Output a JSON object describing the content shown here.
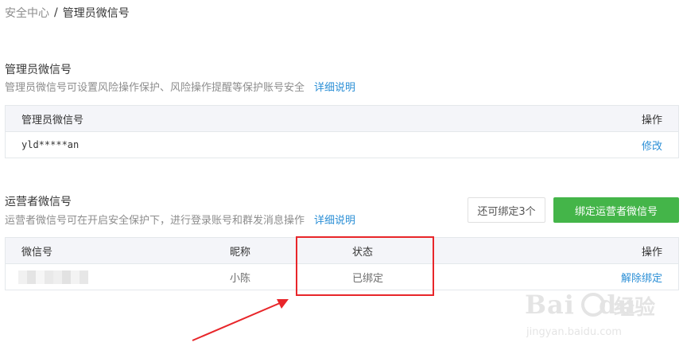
{
  "breadcrumb": {
    "parent": "安全中心",
    "separator": "/",
    "current": "管理员微信号"
  },
  "admin_section": {
    "title": "管理员微信号",
    "description": "管理员微信号可设置风险操作保护、风险操作提醒等保护账号安全",
    "detail_link": "详细说明",
    "table": {
      "headers": {
        "wechat_id": "管理员微信号",
        "action": "操作"
      },
      "rows": [
        {
          "wechat_id": "yld*****an",
          "action": "修改"
        }
      ]
    }
  },
  "operator_section": {
    "title": "运营者微信号",
    "description": "运营者微信号可在开启安全保护下，进行登录账号和群发消息操作",
    "detail_link": "详细说明",
    "remaining_label": "还可绑定3个",
    "bind_button": "绑定运营者微信号",
    "table": {
      "headers": {
        "wechat_id": "微信号",
        "nickname": "昵称",
        "status": "状态",
        "action": "操作"
      },
      "rows": [
        {
          "wechat_id": "",
          "nickname": "小陈",
          "status": "已绑定",
          "action": "解除绑定"
        }
      ]
    }
  },
  "watermark": {
    "brand": "Bai",
    "brand_tail": "du",
    "cn": "经验",
    "url": "jingyan.baidu.com"
  },
  "colors": {
    "link": "#2b8fd6",
    "primary_button": "#44b549",
    "annotation_red": "#e8262a",
    "table_header_bg": "#f4f5f9"
  }
}
